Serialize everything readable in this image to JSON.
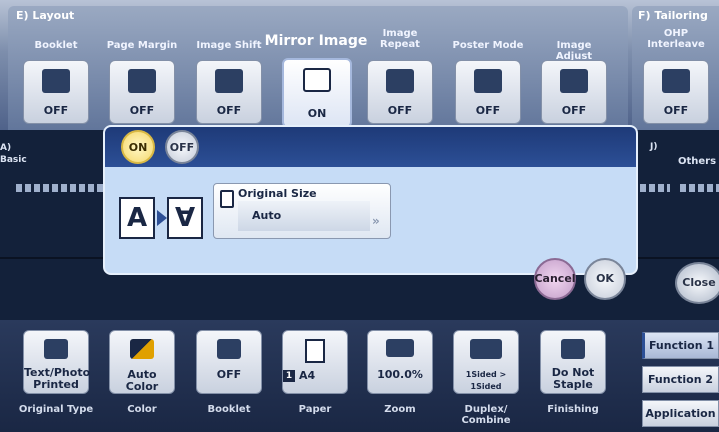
{
  "layout_section": {
    "title": "E)  Layout",
    "functions": [
      {
        "label": "Booklet",
        "value": "OFF"
      },
      {
        "label": "Page Margin",
        "value": "OFF"
      },
      {
        "label": "Image Shift",
        "value": "OFF"
      },
      {
        "label": "Mirror Image",
        "value": "ON"
      },
      {
        "label": "Image Repeat",
        "value": "OFF"
      },
      {
        "label": "Poster Mode",
        "value": "OFF"
      },
      {
        "label": "Image Adjust",
        "value": "OFF"
      }
    ]
  },
  "tailoring_section": {
    "title": "F)  Tailoring",
    "functions": [
      {
        "label": "OHP Interleave",
        "value": "OFF"
      }
    ]
  },
  "side_tabs": {
    "left": "A)\nBasic",
    "right_letter": "J)",
    "right_label": "Others"
  },
  "dialog": {
    "toggle_on": "ON",
    "toggle_off": "OFF",
    "mirror_glyph_a": "A",
    "mirror_glyph_b": "∀",
    "original_size": {
      "title": "Original Size",
      "value": "Auto"
    },
    "cancel": "Cancel",
    "ok": "OK"
  },
  "close": "Close",
  "bottom_bar": [
    {
      "value": "Text/Photo\nPrinted",
      "label": "Original Type"
    },
    {
      "value": "Auto Color",
      "label": "Color"
    },
    {
      "value": "OFF",
      "label": "Booklet"
    },
    {
      "value": "A4",
      "badge": "1",
      "label": "Paper"
    },
    {
      "value": "100.0%",
      "label": "Zoom"
    },
    {
      "value": "1Sided > 1Sided",
      "label": "Duplex/\nCombine"
    },
    {
      "value": "Do Not\nStaple",
      "label": "Finishing"
    }
  ],
  "right_tabs": [
    "Function 1",
    "Function 2",
    "Application"
  ],
  "colors": {
    "accent": "#2c4f96",
    "on_state": "#f5d86a",
    "dialog_bg": "#c6dcf6"
  }
}
